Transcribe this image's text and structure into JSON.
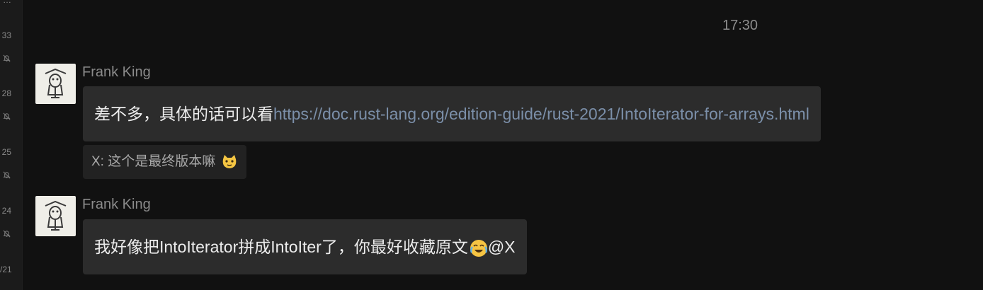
{
  "sidebar": {
    "labels": [
      "…",
      "33",
      "28",
      "25",
      "24",
      "/21"
    ]
  },
  "chat": {
    "timestamp": "17:30",
    "messages": [
      {
        "sender": "Frank King",
        "text": "差不多，具体的话可以看",
        "link": "https://doc.rust-lang.org/edition-guide/rust-2021/IntoIterator-for-arrays.html"
      },
      {
        "quote": "X: 这个是最终版本嘛",
        "quote_emoji": "cat-face-emoji"
      },
      {
        "sender": "Frank King",
        "text": "我好像把IntoIterator拼成IntoIter了，你最好收藏原文",
        "emoji": "laughing-crying-emoji",
        "mention": "@X"
      }
    ]
  }
}
